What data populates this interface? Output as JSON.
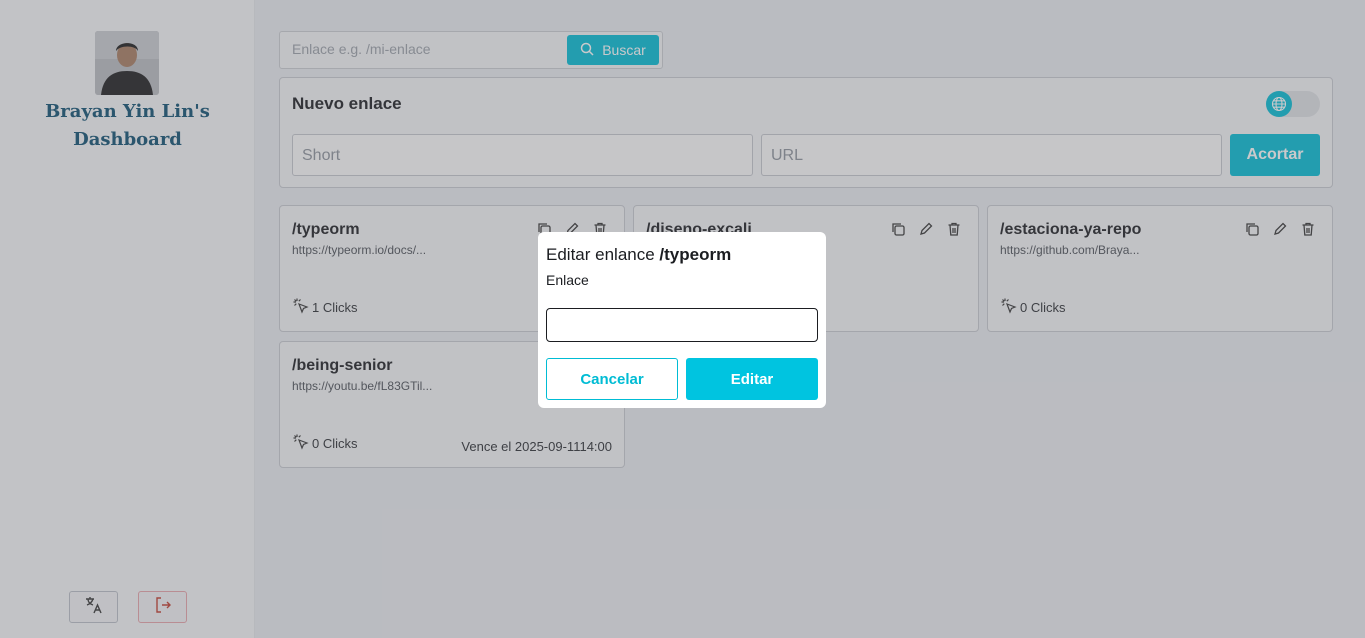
{
  "sidebar": {
    "user_name": "Brayan Yin Lin's Dashboard",
    "buttons": {
      "translate_icon": "translate-icon",
      "logout_icon": "logout-icon"
    }
  },
  "search": {
    "placeholder": "Enlace e.g. /mi-enlace",
    "button_label": "Buscar"
  },
  "new_link": {
    "title": "Nuevo enlace",
    "short_placeholder": "Short",
    "url_placeholder": "URL",
    "submit_label": "Acortar"
  },
  "links": [
    {
      "short": "/typeorm",
      "url": "https://typeorm.io/docs/...",
      "clicks": "1 Clicks",
      "expires": ""
    },
    {
      "short": "/diseno-excali",
      "url": "",
      "clicks": "",
      "expires": ""
    },
    {
      "short": "/estaciona-ya-repo",
      "url": "https://github.com/Braya...",
      "clicks": "0 Clicks",
      "expires": ""
    },
    {
      "short": "/being-senior",
      "url": "https://youtu.be/fL83GTil...",
      "clicks": "0 Clicks",
      "expires": "Vence el 2025-09-1114:00"
    }
  ],
  "modal": {
    "title_prefix": "Editar enlance",
    "title_link": "/typeorm",
    "label": "Enlace",
    "input_value": "",
    "cancel_label": "Cancelar",
    "confirm_label": "Editar"
  },
  "colors": {
    "accent": "#00bcd4",
    "name_color": "#0d4f70",
    "danger": "#e7a3a9"
  }
}
